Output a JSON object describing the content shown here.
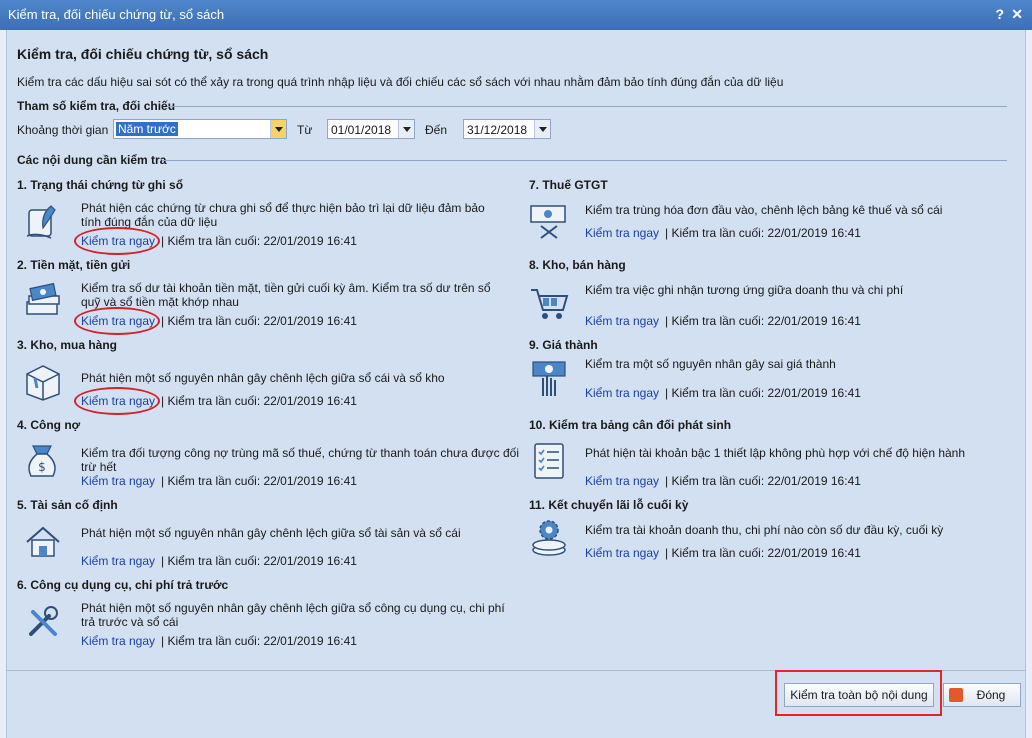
{
  "window": {
    "title": "Kiểm tra, đối chiếu chứng từ, sổ sách",
    "help": "?",
    "close": "✕"
  },
  "header": {
    "title": "Kiểm tra, đối chiếu chứng từ, sổ sách",
    "description": "Kiểm tra các dấu hiệu sai sót có thể xảy ra trong quá trình nhập liệu và đối chiếu các sổ sách với nhau nhằm đảm bảo tính đúng đắn của dữ liệu"
  },
  "params": {
    "section_title": "Tham số kiểm tra, đối chiếu",
    "period_label": "Khoảng thời gian",
    "period_value": "Năm trước",
    "from_label": "Từ",
    "from_value": "01/01/2018",
    "to_label": "Đến",
    "to_value": "31/12/2018"
  },
  "content": {
    "section_title": "Các nội dung cần kiểm tra",
    "link_label": "Kiểm tra ngay",
    "last_text": "| Kiểm tra lần cuối: 22/01/2019 16:41",
    "items": [
      {
        "title": "1. Trạng thái chứng từ ghi sổ",
        "desc": "Phát hiện các chứng từ chưa ghi sổ để thực hiện bảo trì lại dữ liệu đảm bảo tính đúng đắn của dữ liệu",
        "icon": "quill-icon"
      },
      {
        "title": "2. Tiền mặt, tiền gửi",
        "desc": "Kiểm tra số dư tài khoản tiền mặt, tiền gửi cuối kỳ âm. Kiểm tra số dư trên sổ quỹ và sổ tiền mặt khớp nhau",
        "icon": "money-stack-icon"
      },
      {
        "title": "3. Kho, mua hàng",
        "desc": "Phát hiện một số nguyên nhân gây chênh lệch giữa sổ cái và sổ kho",
        "icon": "box-icon"
      },
      {
        "title": "4. Công nợ",
        "desc": "Kiểm tra đối tượng công nợ trùng mã số thuế, chứng từ thanh toán chưa được đối trừ hết",
        "icon": "money-bag-icon"
      },
      {
        "title": "5. Tài sản cố định",
        "desc": "Phát hiện một số nguyên nhân gây chênh lệch giữa sổ tài sản và sổ cái",
        "icon": "house-icon"
      },
      {
        "title": "6. Công cụ dụng cụ, chi phí trả trước",
        "desc": "Phát hiện một số nguyên nhân gây chênh lệch giữa sổ công cụ dụng cụ, chi phí trả trước và sổ cái",
        "icon": "tools-icon"
      },
      {
        "title": "7. Thuế GTGT",
        "desc": "Kiểm tra trùng hóa đơn đầu vào, chênh lệch bảng kê thuế và sổ cái",
        "icon": "invoice-scissors-icon"
      },
      {
        "title": "8. Kho, bán hàng",
        "desc": "Kiểm tra việc ghi nhận tương ứng giữa doanh thu và chi phí",
        "icon": "shopping-cart-icon"
      },
      {
        "title": "9. Giá thành",
        "desc": "Kiểm tra một số nguyên nhân gây sai giá thành",
        "icon": "hand-money-icon"
      },
      {
        "title": "10. Kiểm tra bảng cân đối phát sinh",
        "desc": "Phát hiện tài khoản bậc 1 thiết lập không phù hợp với chế độ hiện hành",
        "icon": "checklist-icon"
      },
      {
        "title": "11. Kết chuyển lãi lỗ cuối kỳ",
        "desc": "Kiểm tra tài khoản doanh thu, chi phí nào còn số dư đầu kỳ, cuối kỳ",
        "icon": "gear-coins-icon"
      }
    ]
  },
  "footer": {
    "check_all_label": "Kiểm tra toàn bộ nội dung",
    "close_label": "Đóng"
  },
  "colors": {
    "titlebar": "#3d6fb3",
    "link": "#1b3fa8",
    "highlight": "#d2232a"
  }
}
